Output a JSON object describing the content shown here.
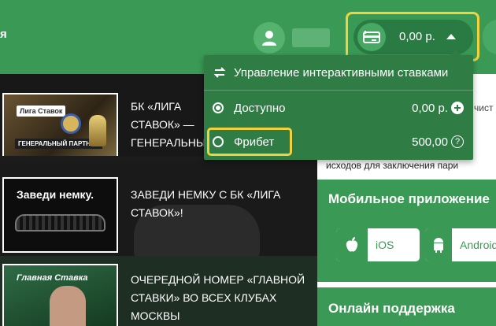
{
  "header": {
    "edge_text": "я",
    "balance": "0,00 р."
  },
  "dropdown": {
    "manage_label": "Управление интерактивными ставками",
    "available_label": "Доступно",
    "available_value": "0,00 р.",
    "freebet_label": "Фрибет",
    "freebet_value": "500,00",
    "help_glyph": "?"
  },
  "news": [
    {
      "title": "БК «ЛИГА СТАВОК» — ГЕНЕРАЛЬНЫЙ ПАРТНЕР ЧР-2017/18 ПО",
      "thumb_label": "Лига Ставок"
    },
    {
      "title": "ЗАВЕДИ НЕМКУ С БК «ЛИГА СТАВОК»!",
      "thumb_label": "Заведи немку."
    },
    {
      "title": "ОЧЕРЕДНОЙ НОМЕР «ГЛАВНОЙ СТАВКИ» ВО ВСЕХ КЛУБАХ МОСКВЫ",
      "thumb_label": "Главная Ставка"
    }
  ],
  "news1_partner": "ГЕНЕРАЛЬНЫЙ ПАРТНЕР",
  "side": {
    "text": "добавьте один или несколько исходов для заключения пари",
    "edge_text": "чист"
  },
  "mobile": {
    "title": "Мобильное приложение",
    "ios_label": "iOS",
    "android_label": "Android"
  },
  "support": {
    "title": "Онлайн поддержка"
  },
  "colors": {
    "brand_green": "#3a9a55",
    "dark_green": "#2f7d45",
    "highlight": "#f2d23c"
  },
  "icons": [
    "user-icon",
    "wallet-icon",
    "caret-up-icon",
    "swap-icon",
    "plus-circle-icon",
    "help-icon",
    "apple-icon",
    "android-icon"
  ]
}
